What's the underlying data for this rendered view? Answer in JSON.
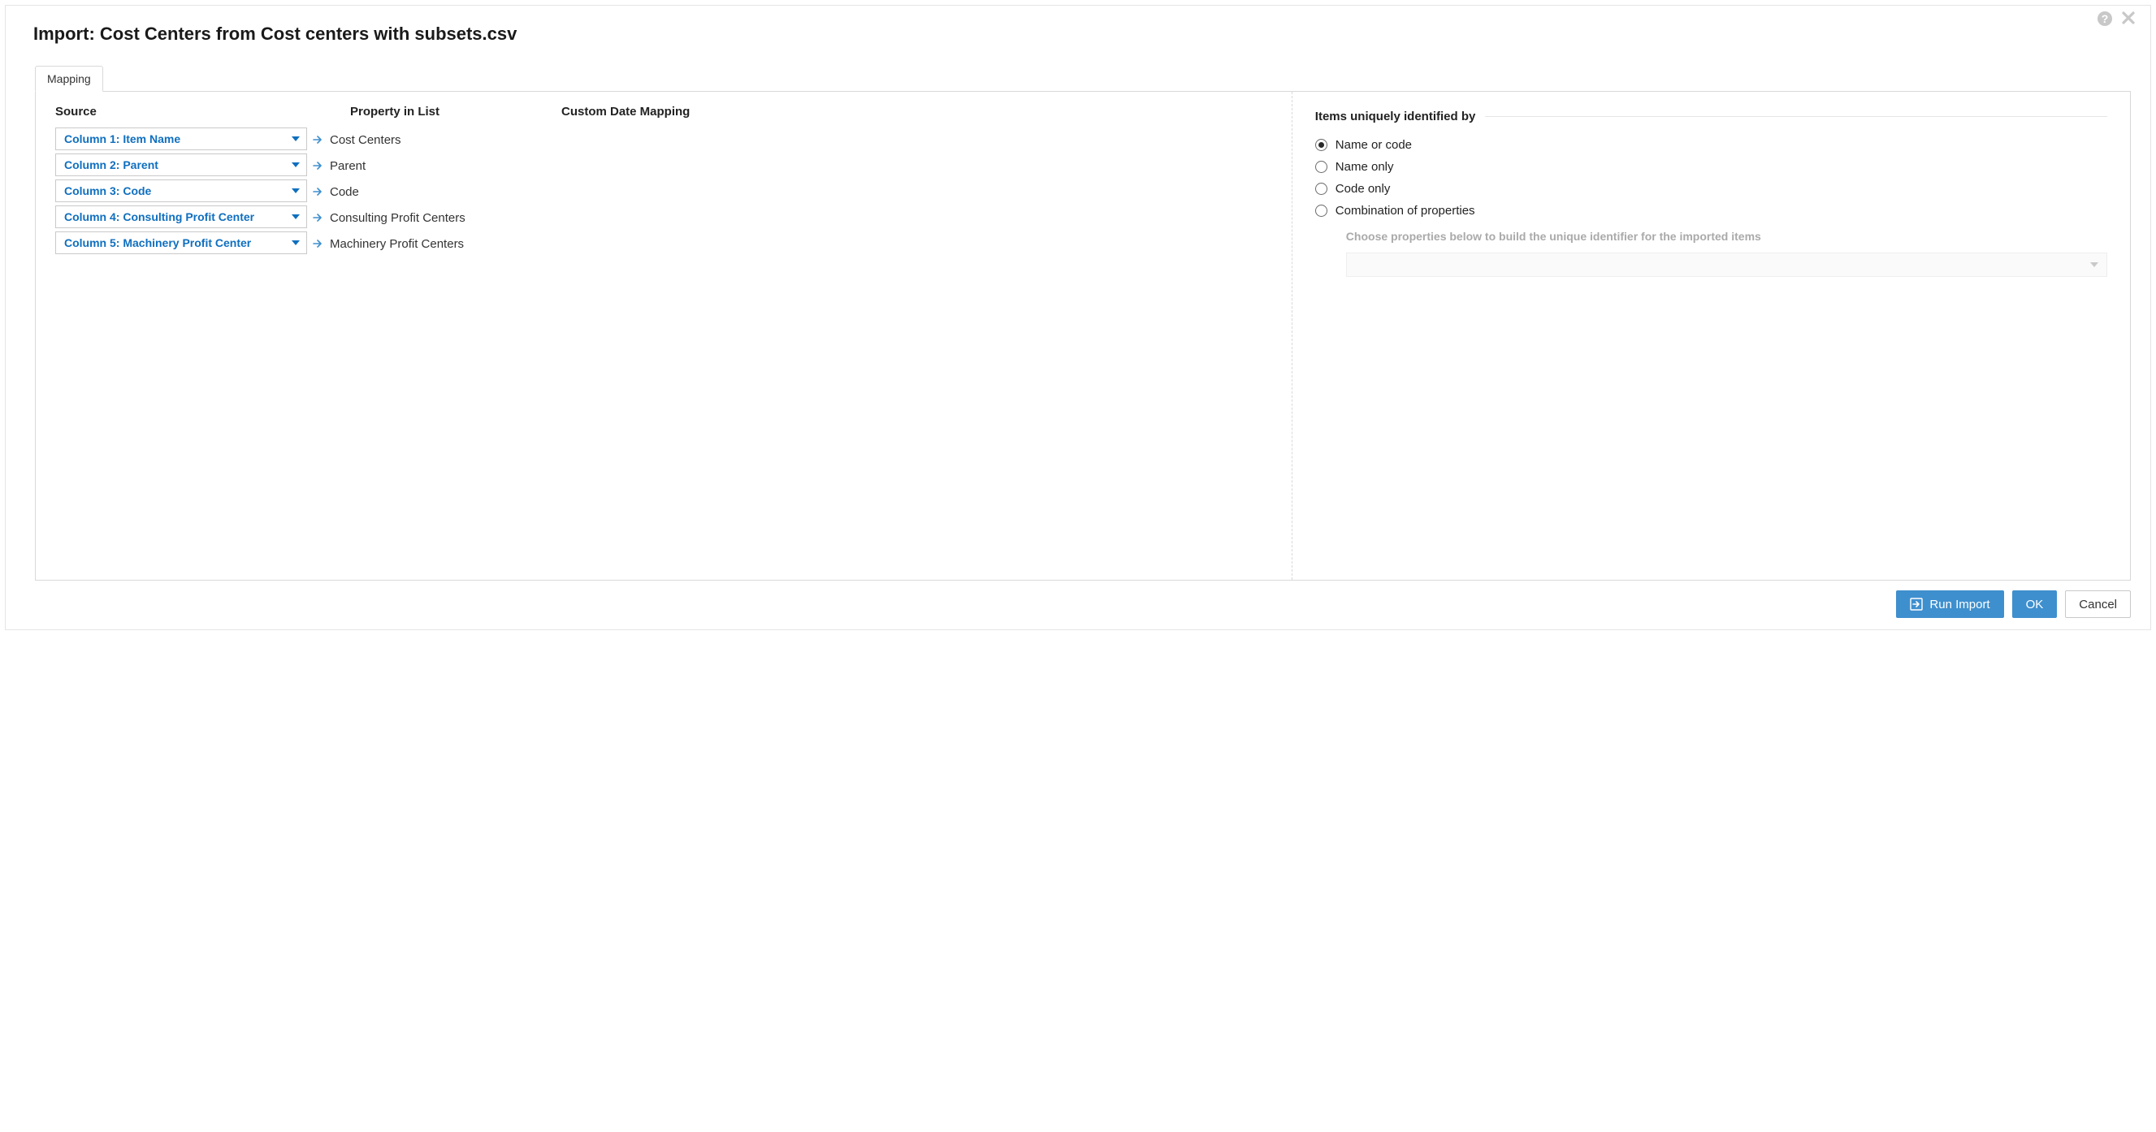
{
  "title": "Import: Cost Centers from Cost centers with subsets.csv",
  "tab_label": "Mapping",
  "headers": {
    "source": "Source",
    "property": "Property in List",
    "custom_date": "Custom Date Mapping"
  },
  "rows": [
    {
      "source": "Column 1: Item Name",
      "property": "Cost Centers"
    },
    {
      "source": "Column 2: Parent",
      "property": "Parent"
    },
    {
      "source": "Column 3: Code",
      "property": "Code"
    },
    {
      "source": "Column 4: Consulting Profit Center",
      "property": "Consulting Profit Centers"
    },
    {
      "source": "Column 5: Machinery Profit Center",
      "property": "Machinery Profit Centers"
    }
  ],
  "identify": {
    "section_label": "Items uniquely identified by",
    "options": [
      "Name or code",
      "Name only",
      "Code only",
      "Combination of properties"
    ],
    "selected_index": 0,
    "hint": "Choose properties below to build the unique identifier for the imported items"
  },
  "footer": {
    "run_import": "Run Import",
    "ok": "OK",
    "cancel": "Cancel"
  }
}
